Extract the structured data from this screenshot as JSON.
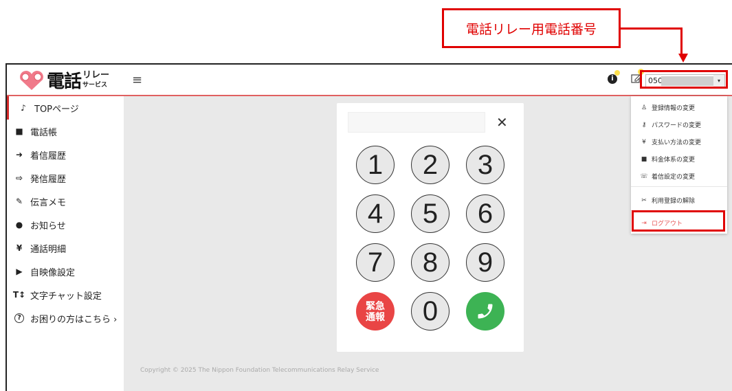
{
  "callout": {
    "text": "電話リレー用電話番号"
  },
  "header": {
    "logo_main": "電話",
    "logo_sub_top": "リレー",
    "logo_sub_bottom": "サービス",
    "phone_prefix": "050",
    "select_caret": "▾"
  },
  "sidebar": {
    "items": [
      {
        "label": "TOPページ",
        "icon": "♪"
      },
      {
        "label": "電話帳",
        "icon": "■"
      },
      {
        "label": "着信履歴",
        "icon": "➜"
      },
      {
        "label": "発信履歴",
        "icon": "⇨"
      },
      {
        "label": "伝言メモ",
        "icon": "✎"
      },
      {
        "label": "お知らせ",
        "icon": "●"
      },
      {
        "label": "通話明細",
        "icon": "¥"
      },
      {
        "label": "自映像設定",
        "icon": "▶"
      },
      {
        "label": "文字チャット設定",
        "icon": "T↕"
      },
      {
        "label": "お困りの方はこちら ›",
        "icon": "?"
      }
    ]
  },
  "dialpad": {
    "clear": "✕",
    "keys": [
      "1",
      "2",
      "3",
      "4",
      "5",
      "6",
      "7",
      "8",
      "9",
      "0"
    ],
    "emergency_line1": "緊急",
    "emergency_line2": "通報",
    "call_icon": "phone-icon"
  },
  "dropdown": {
    "items": [
      {
        "label": "登録情報の変更",
        "icon": "♙"
      },
      {
        "label": "パスワードの変更",
        "icon": "⚷"
      },
      {
        "label": "支払い方法の変更",
        "icon": "¥"
      },
      {
        "label": "料金体系の変更",
        "icon": "■"
      },
      {
        "label": "着信設定の変更",
        "icon": "☏"
      },
      {
        "label": "利用登録の解除",
        "icon": "✂"
      },
      {
        "label": "ログアウト",
        "icon": "⇥"
      }
    ]
  },
  "footer": {
    "copyright": "Copyright © 2025 The Nippon Foundation Telecommunications Relay Service"
  },
  "colors": {
    "accent_red": "#e00000",
    "call_green": "#3db354",
    "emergency_red": "#e94545"
  }
}
